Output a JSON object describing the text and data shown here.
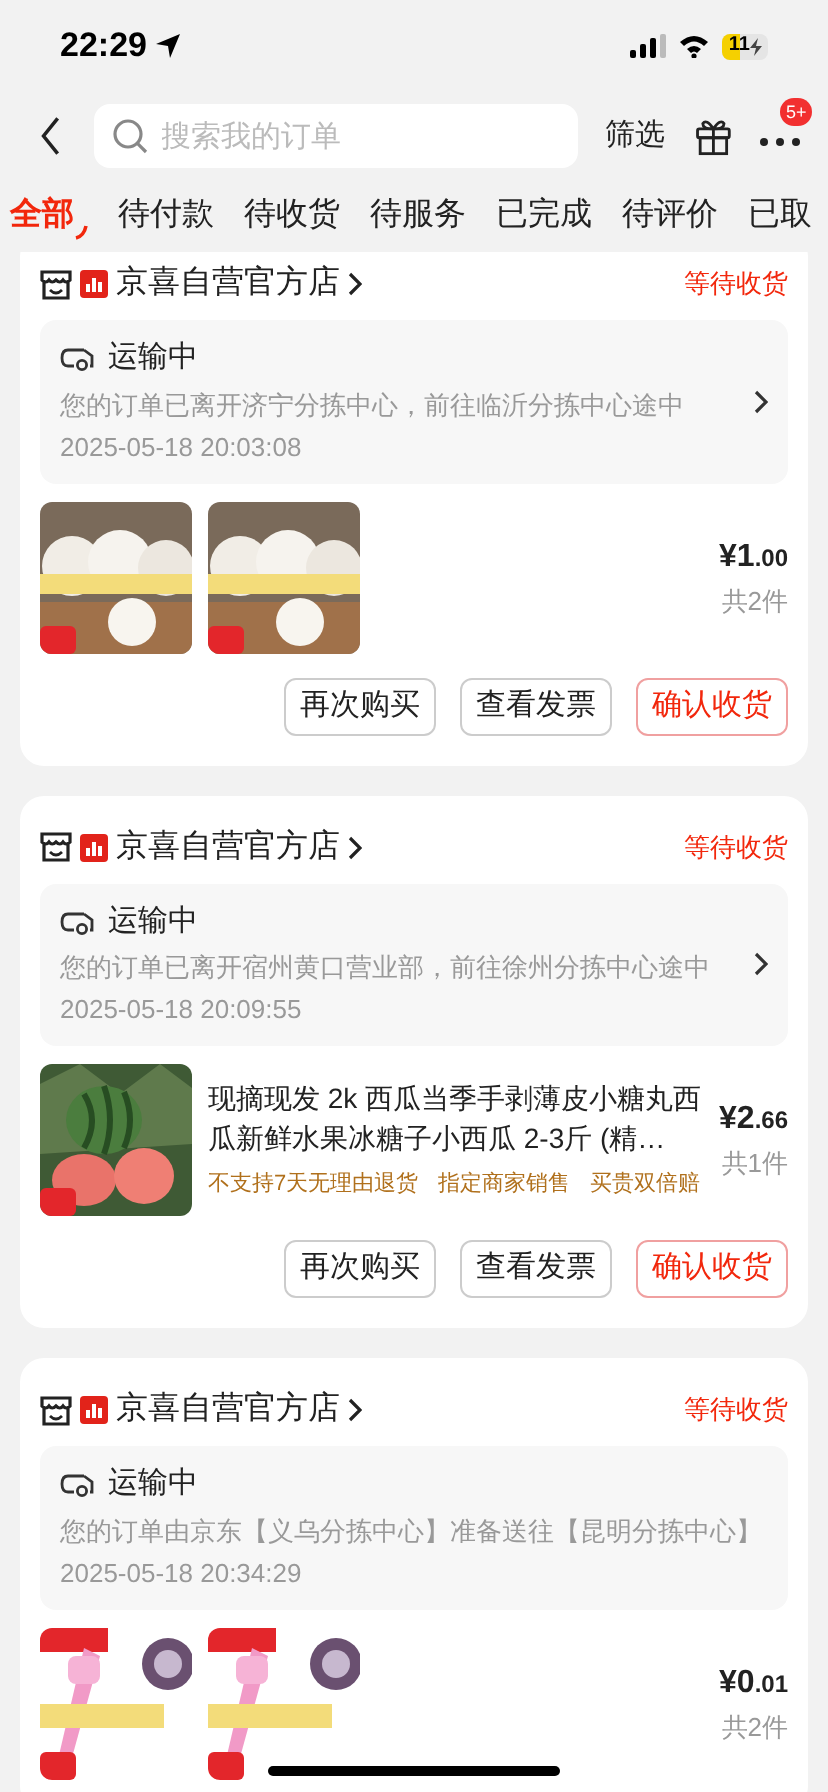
{
  "status_bar": {
    "time": "22:29",
    "battery": "11"
  },
  "header": {
    "search": {
      "placeholder": "搜索我的订单"
    },
    "filter": "筛选",
    "more_badge": "5+"
  },
  "tabs": [
    {
      "label": "全部",
      "selected": true
    },
    {
      "label": "待付款",
      "selected": false
    },
    {
      "label": "待收货",
      "selected": false
    },
    {
      "label": "待服务",
      "selected": false
    },
    {
      "label": "已完成",
      "selected": false
    },
    {
      "label": "待评价",
      "selected": false
    },
    {
      "label": "已取",
      "selected": false
    }
  ],
  "orders": [
    {
      "store": "京喜自营官方店",
      "status": "等待收货",
      "tracking": {
        "title": "运输中",
        "message": "您的订单已离开济宁分拣中心，前往临沂分拣中心途中",
        "time": "2025-05-18 20:03:08"
      },
      "price": "¥1.00",
      "quantity": "共2件",
      "buttons": [
        {
          "label": "再次购买",
          "kind": "normal"
        },
        {
          "label": "查看发票",
          "kind": "normal"
        },
        {
          "label": "确认收货",
          "kind": "primary"
        }
      ]
    },
    {
      "store": "京喜自营官方店",
      "status": "等待收货",
      "tracking": {
        "title": "运输中",
        "message": "您的订单已离开宿州黄口营业部，前往徐州分拣中心途中",
        "time": "2025-05-18 20:09:55"
      },
      "title": "现摘现发 2k 西瓜当季手剥薄皮小糖丸西瓜新鲜水果冰糖子小西瓜 2-3斤 (精…",
      "tags": [
        "不支持7天无理由退货",
        "指定商家销售",
        "买贵双倍赔"
      ],
      "price": "¥2.66",
      "quantity": "共1件",
      "buttons": [
        {
          "label": "再次购买",
          "kind": "normal"
        },
        {
          "label": "查看发票",
          "kind": "normal"
        },
        {
          "label": "确认收货",
          "kind": "primary"
        }
      ]
    },
    {
      "store": "京喜自营官方店",
      "status": "等待收货",
      "tracking": {
        "title": "运输中",
        "message": "您的订单由京东【义乌分拣中心】准备送往【昆明分拣中心】",
        "time": "2025-05-18 20:34:29"
      },
      "price": "¥0.01",
      "quantity": "共2件"
    }
  ]
}
